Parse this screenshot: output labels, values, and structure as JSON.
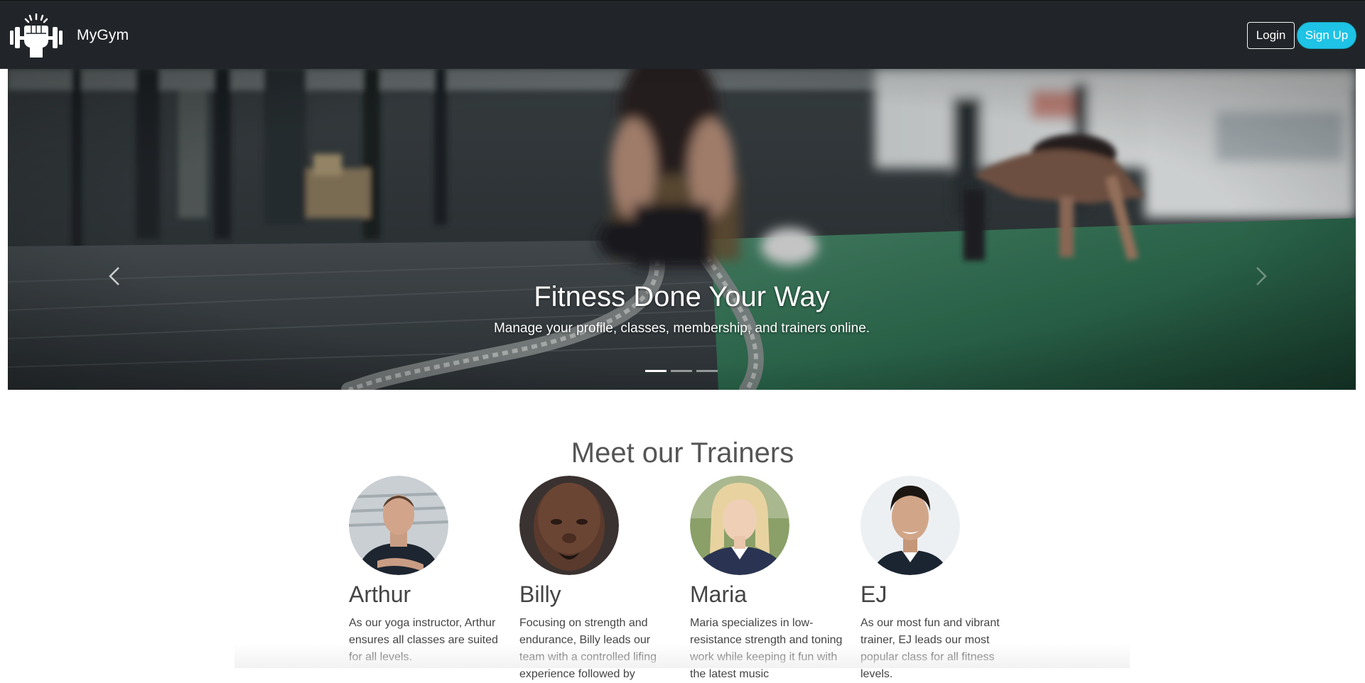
{
  "brand": {
    "name": "MyGym",
    "logo_icon": "fist-dumbbell-icon"
  },
  "nav": {
    "login_label": "Login",
    "signup_label": "Sign Up"
  },
  "colors": {
    "navbar": "#212529",
    "accent": "#1ec3e6"
  },
  "hero": {
    "title": "Fitness Done Your Way",
    "subtitle": "Manage your profile, classes, membership, and trainers online.",
    "slide_count": 3,
    "active_slide": 1,
    "prev_icon": "chevron-left-icon",
    "next_icon": "chevron-right-icon"
  },
  "trainers": {
    "heading": "Meet our Trainers",
    "items": [
      {
        "name": "Arthur",
        "bio": "As our yoga instructor, Arthur ensures all classes are suited for all levels."
      },
      {
        "name": "Billy",
        "bio": "Focusing on strength and endurance, Billy leads our team with a controlled lifing experience followed by"
      },
      {
        "name": "Maria",
        "bio": "Maria specializes in low-resistance strength and toning work while keeping it fun with the latest music"
      },
      {
        "name": "EJ",
        "bio": "As our most fun and vibrant trainer, EJ leads our most popular class for all fitness levels."
      }
    ]
  }
}
